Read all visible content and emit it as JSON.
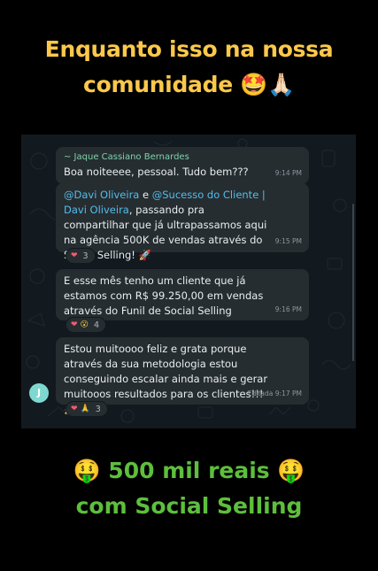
{
  "headline": {
    "line1": "Enquanto isso na nossa",
    "line2": "comunidade 🤩🙏🏻"
  },
  "chat": {
    "messages": [
      {
        "sender": "~ Jaque Cassiano Bernardes",
        "text": "Boa noiteeee, pessoal. Tudo bem???",
        "time": "9:14 PM"
      },
      {
        "mention1": "@Davi Oliveira",
        "conj": " e ",
        "mention2": "@Sucesso do Cliente | Davi Oliveira",
        "text": ", passando pra compartilhar que já ultrapassamos aqui na agência 500K de vendas através do Social Selling! 🚀",
        "time": "9:15 PM",
        "reactions": {
          "emojis": [
            "❤"
          ],
          "count": "3"
        }
      },
      {
        "text": "E esse mês tenho um cliente que já estamos com R$ 99.250,00 em vendas através do Funil de Social Selling",
        "time": "9:16 PM",
        "reactions": {
          "emojis": [
            "❤",
            "😮"
          ],
          "count": "4"
        }
      },
      {
        "text": "Estou muitoooo feliz e grata porque através da sua metodologia estou conseguindo escalar ainda mais e gerar muitooos resultados para os clientes!!! 🚀",
        "time": "Editada 9:17 PM",
        "reactions": {
          "emojis": [
            "❤",
            "🙏"
          ],
          "count": "3"
        }
      }
    ],
    "avatar_initial": "J"
  },
  "footer": {
    "line1": "🤑 500 mil reais 🤑",
    "line2": "com Social Selling"
  },
  "colors": {
    "headline": "#fbc84a",
    "footer": "#5dbf3c",
    "chat_bg": "#12191f",
    "bubble": "#262d31",
    "sender": "#7ed3a9",
    "mention": "#53bdeb"
  }
}
